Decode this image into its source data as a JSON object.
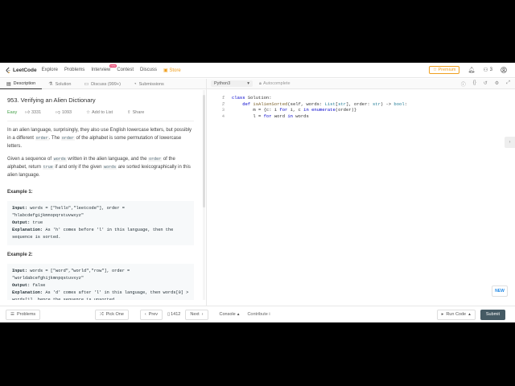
{
  "nav": {
    "logo_text": "LeetCode",
    "items": [
      "Explore",
      "Problems",
      "Interview",
      "Contest",
      "Discuss"
    ],
    "interview_badge": "new",
    "store": "Store",
    "premium": "Premium",
    "coin_count": "3",
    "brand_color": "#f0a020"
  },
  "left_tabs": [
    {
      "icon": "description-icon",
      "label": "Description"
    },
    {
      "icon": "flask-icon",
      "label": "Solution"
    },
    {
      "icon": "discuss-icon",
      "label": "Discuss (999+)"
    },
    {
      "icon": "submissions-icon",
      "label": "Submissions"
    }
  ],
  "problem": {
    "title": "953. Verifying an Alien Dictionary",
    "difficulty": "Easy",
    "likes": "3331",
    "dislikes": "1093",
    "add_to_list": "Add to List",
    "share": "Share",
    "p1a": "In an alien language, surprisingly, they also use English lowercase letters, but possibly in a different ",
    "p1_code": "order",
    "p1b": ". The ",
    "p1_code2": "order",
    "p1c": " of the alphabet is some permutation of lowercase letters.",
    "p2a": "Given a sequence of ",
    "p2_code": "words",
    "p2b": " written in the alien language, and the ",
    "p2_code2": "order",
    "p2c": " of the alphabet, return ",
    "p2_code3": "true",
    "p2d": " if and only if the given ",
    "p2_code4": "words",
    "p2e": " are sorted lexicographically in this alien language.",
    "examples": [
      {
        "title": "Example 1:",
        "input_label": "Input:",
        "input": " words = [\"hello\",\"leetcode\"], order = \"hlabcdefgijkmnopqrstuvwxyz\"",
        "output_label": "Output:",
        "output": " true",
        "expl_label": "Explanation:",
        "expl": " As 'h' comes before 'l' in this language, then the sequence is sorted."
      },
      {
        "title": "Example 2:",
        "input_label": "Input:",
        "input": " words = [\"word\",\"world\",\"row\"], order = \"worldabcefghijkmnpqstuvxyz\"",
        "output_label": "Output:",
        "output": " false",
        "expl_label": "Explanation:",
        "expl": " As 'd' comes after 'l' in this language, then words[0] > words[1], hence the sequence is unsorted."
      }
    ]
  },
  "editor": {
    "language": "Python3",
    "autocomplete": "Autocomplete",
    "line_numbers": [
      "1",
      "2",
      "3",
      "4"
    ]
  },
  "bottom": {
    "problems": "Problems",
    "pick_one": "Pick One",
    "prev": "Prev",
    "page": "1412",
    "next": "Next",
    "console": "Console",
    "contribute": "Contribute i",
    "run_code": "Run Code",
    "submit": "Submit"
  },
  "new_fab": "NEW"
}
